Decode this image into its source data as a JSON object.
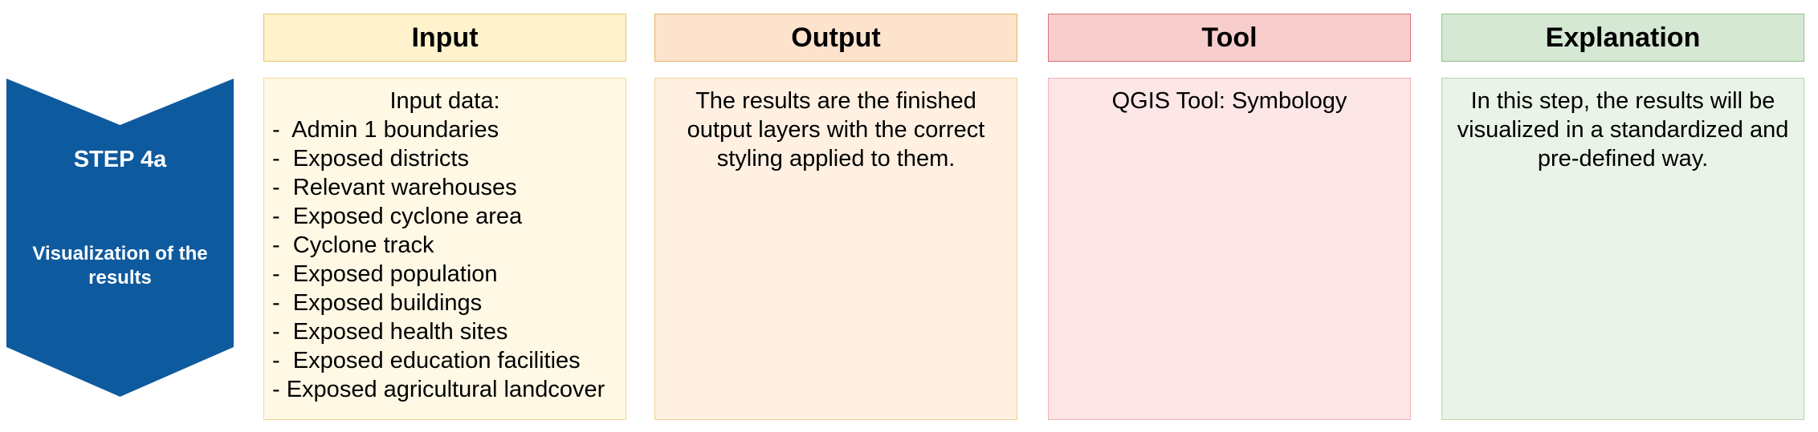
{
  "step": {
    "title": "STEP 4a",
    "subtitle": "Visualization of the results"
  },
  "columns": {
    "input": {
      "header": "Input",
      "intro": "Input data:",
      "items": [
        "-  Admin 1 boundaries",
        "-  Exposed districts",
        "-  Relevant warehouses",
        "-  Exposed cyclone area",
        "-  Cyclone track",
        "-  Exposed population",
        "-  Exposed buildings",
        "-  Exposed health sites",
        "-  Exposed education facilities",
        "- Exposed agricultural landcover"
      ]
    },
    "output": {
      "header": "Output",
      "text": "The results are the finished output layers with the correct styling applied to them."
    },
    "tool": {
      "header": "Tool",
      "text": "QGIS Tool: Symbology"
    },
    "explanation": {
      "header": "Explanation",
      "text": "In this step, the results will be visualized in a standardized and pre-defined way."
    }
  },
  "colors": {
    "step_blue": "#0e5a9e",
    "input_header": "#fff2cc",
    "output_header": "#fde3cc",
    "tool_header": "#f8cecc",
    "explanation_header": "#d5e8d4"
  }
}
